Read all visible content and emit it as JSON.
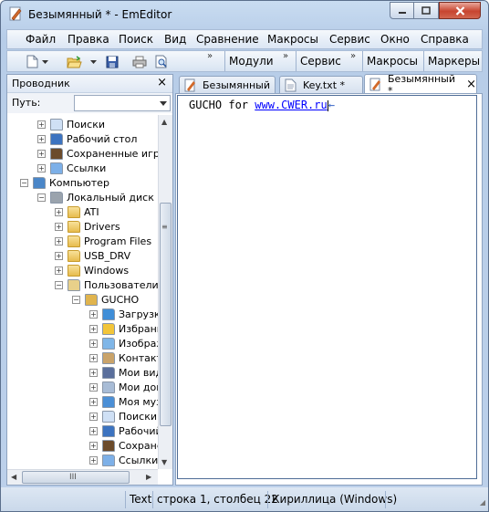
{
  "window": {
    "title": "Безымянный * - EmEditor",
    "app_icon": "emeditor-icon",
    "controls": {
      "minimize": "minimize-icon",
      "maximize": "maximize-icon",
      "close": "close-icon"
    }
  },
  "menu": {
    "items": [
      "Файл",
      "Правка",
      "Поиск",
      "Вид",
      "Сравнение",
      "Макросы",
      "Сервис",
      "Окно",
      "Справка"
    ]
  },
  "toolbar": {
    "icons": [
      "new-file-icon",
      "dropdown-arrow-icon",
      "open-folder-icon",
      "dropdown-arrow-icon",
      "save-icon",
      "print-icon",
      "print-preview-icon"
    ],
    "overflow": "»",
    "groups": [
      "Модули",
      "Сервис",
      "Макросы",
      "Маркеры"
    ]
  },
  "sidebar": {
    "title": "Проводник",
    "close": "×",
    "path_label": "Путь:",
    "path_value": "",
    "tree": [
      {
        "label": "Поиски",
        "depth": 1,
        "expander": "+",
        "icon": "search-folder-icon"
      },
      {
        "label": "Рабочий стол",
        "depth": 1,
        "expander": "+",
        "icon": "desktop-folder-icon"
      },
      {
        "label": "Сохраненные игры",
        "depth": 1,
        "expander": "+",
        "icon": "saved-games-icon"
      },
      {
        "label": "Ссылки",
        "depth": 1,
        "expander": "+",
        "icon": "links-folder-icon"
      },
      {
        "label": "Компьютер",
        "depth": 0,
        "expander": "−",
        "icon": "computer-icon"
      },
      {
        "label": "Локальный диск (C",
        "depth": 1,
        "expander": "−",
        "icon": "drive-icon"
      },
      {
        "label": "ATI",
        "depth": 2,
        "expander": "+",
        "icon": "folder-icon"
      },
      {
        "label": "Drivers",
        "depth": 2,
        "expander": "+",
        "icon": "folder-icon"
      },
      {
        "label": "Program Files",
        "depth": 2,
        "expander": "+",
        "icon": "folder-icon"
      },
      {
        "label": "USB_DRV",
        "depth": 2,
        "expander": "+",
        "icon": "folder-icon"
      },
      {
        "label": "Windows",
        "depth": 2,
        "expander": "+",
        "icon": "folder-icon"
      },
      {
        "label": "Пользователи",
        "depth": 2,
        "expander": "−",
        "icon": "users-folder-icon"
      },
      {
        "label": "GUCHO",
        "depth": 3,
        "expander": "−",
        "icon": "user-folder-icon"
      },
      {
        "label": "Загрузк",
        "depth": 4,
        "expander": "+",
        "icon": "downloads-folder-icon"
      },
      {
        "label": "Избранн",
        "depth": 4,
        "expander": "+",
        "icon": "favorites-folder-icon"
      },
      {
        "label": "Изображ",
        "depth": 4,
        "expander": "+",
        "icon": "pictures-folder-icon"
      },
      {
        "label": "Контакт",
        "depth": 4,
        "expander": "+",
        "icon": "contacts-folder-icon"
      },
      {
        "label": "Мои вид",
        "depth": 4,
        "expander": "+",
        "icon": "videos-folder-icon"
      },
      {
        "label": "Мои док",
        "depth": 4,
        "expander": "+",
        "icon": "documents-folder-icon"
      },
      {
        "label": "Моя муз",
        "depth": 4,
        "expander": "+",
        "icon": "music-folder-icon"
      },
      {
        "label": "Поиски",
        "depth": 4,
        "expander": "+",
        "icon": "search-folder-icon"
      },
      {
        "label": "Рабочий",
        "depth": 4,
        "expander": "+",
        "icon": "desktop-folder-icon"
      },
      {
        "label": "Сохране",
        "depth": 4,
        "expander": "+",
        "icon": "saved-games-icon"
      },
      {
        "label": "Ссылки",
        "depth": 4,
        "expander": "+",
        "icon": "links-folder-icon"
      }
    ],
    "scroll_arrows": {
      "up": "▲",
      "down": "▼",
      "left": "◀",
      "right": "▶"
    },
    "grip": "≡",
    "hgrip": "III"
  },
  "tabs": [
    {
      "label": "Безымянный",
      "icon": "document-edit-icon",
      "active": false
    },
    {
      "label": "Key.txt *",
      "icon": "text-file-icon",
      "active": false
    },
    {
      "label": "Безымянный *",
      "icon": "document-edit-icon",
      "active": true,
      "close": "×"
    }
  ],
  "editor": {
    "text_prefix": "GUCHO for ",
    "url": "www.CWER.ru",
    "text_suffix": "←"
  },
  "status": {
    "mode": "Text",
    "position": "строка 1, столбец 22",
    "encoding": "Кириллица (Windows)"
  },
  "colors": {
    "accent": "#b7cde8",
    "close_button": "#c7442f",
    "url": "#0000ff"
  }
}
